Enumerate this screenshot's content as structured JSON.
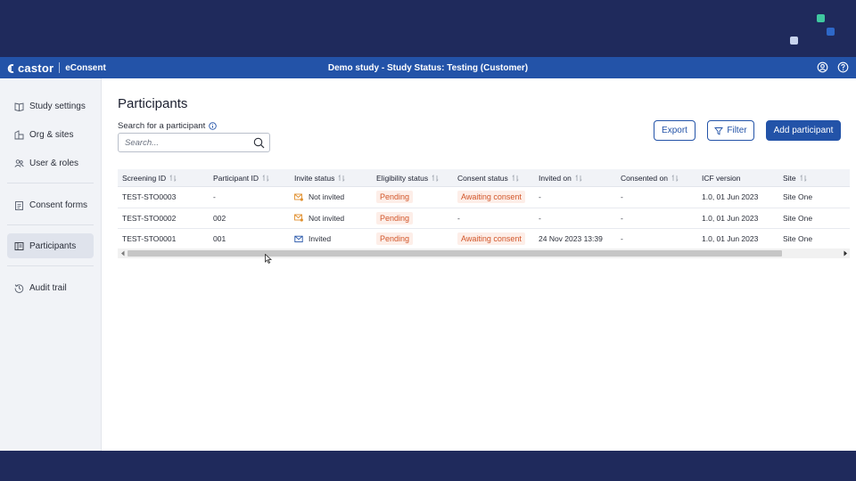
{
  "appbar": {
    "brand_name": "castor",
    "product": "eConsent",
    "study_title": "Demo study  - Study Status: Testing (Customer)",
    "brand_color": "#2353a8"
  },
  "sidebar": {
    "items": [
      {
        "label": "Study settings",
        "icon": "book-icon"
      },
      {
        "label": "Org & sites",
        "icon": "buildings-icon"
      },
      {
        "label": "User & roles",
        "icon": "users-icon"
      },
      {
        "label": "Consent forms",
        "icon": "clipboard-icon"
      },
      {
        "label": "Participants",
        "icon": "participants-icon",
        "active": true
      },
      {
        "label": "Audit trail",
        "icon": "history-icon"
      }
    ]
  },
  "main": {
    "title": "Participants",
    "search_label": "Search for a participant",
    "search_placeholder": "Search...",
    "export_label": "Export",
    "filter_label": "Filter",
    "add_label": "Add participant"
  },
  "table": {
    "headers": [
      "Screening ID",
      "Participant ID",
      "Invite status",
      "Eligibility status",
      "Consent status",
      "Invited on",
      "Consented on",
      "ICF version",
      "Site"
    ],
    "rows": [
      {
        "screening_id": "TEST-STO0003",
        "participant_id": "-",
        "invite_status": "Not invited",
        "invite_icon": "mail-warning-icon",
        "eligibility": "Pending",
        "consent": "Awaiting consent",
        "invited_on": "-",
        "consented_on": "-",
        "icf": "1.0, 01 Jun 2023",
        "site": "Site One"
      },
      {
        "screening_id": "TEST-STO0002",
        "participant_id": "002",
        "invite_status": "Not invited",
        "invite_icon": "mail-warning-icon",
        "eligibility": "Pending",
        "consent": "-",
        "invited_on": "-",
        "consented_on": "-",
        "icf": "1.0, 01 Jun 2023",
        "site": "Site One"
      },
      {
        "screening_id": "TEST-STO0001",
        "participant_id": "001",
        "invite_status": "Invited",
        "invite_icon": "mail-icon",
        "eligibility": "Pending",
        "consent": "Awaiting consent",
        "invited_on": "24 Nov 2023 13:39",
        "consented_on": "-",
        "icf": "1.0, 01 Jun 2023",
        "site": "Site One"
      }
    ]
  }
}
